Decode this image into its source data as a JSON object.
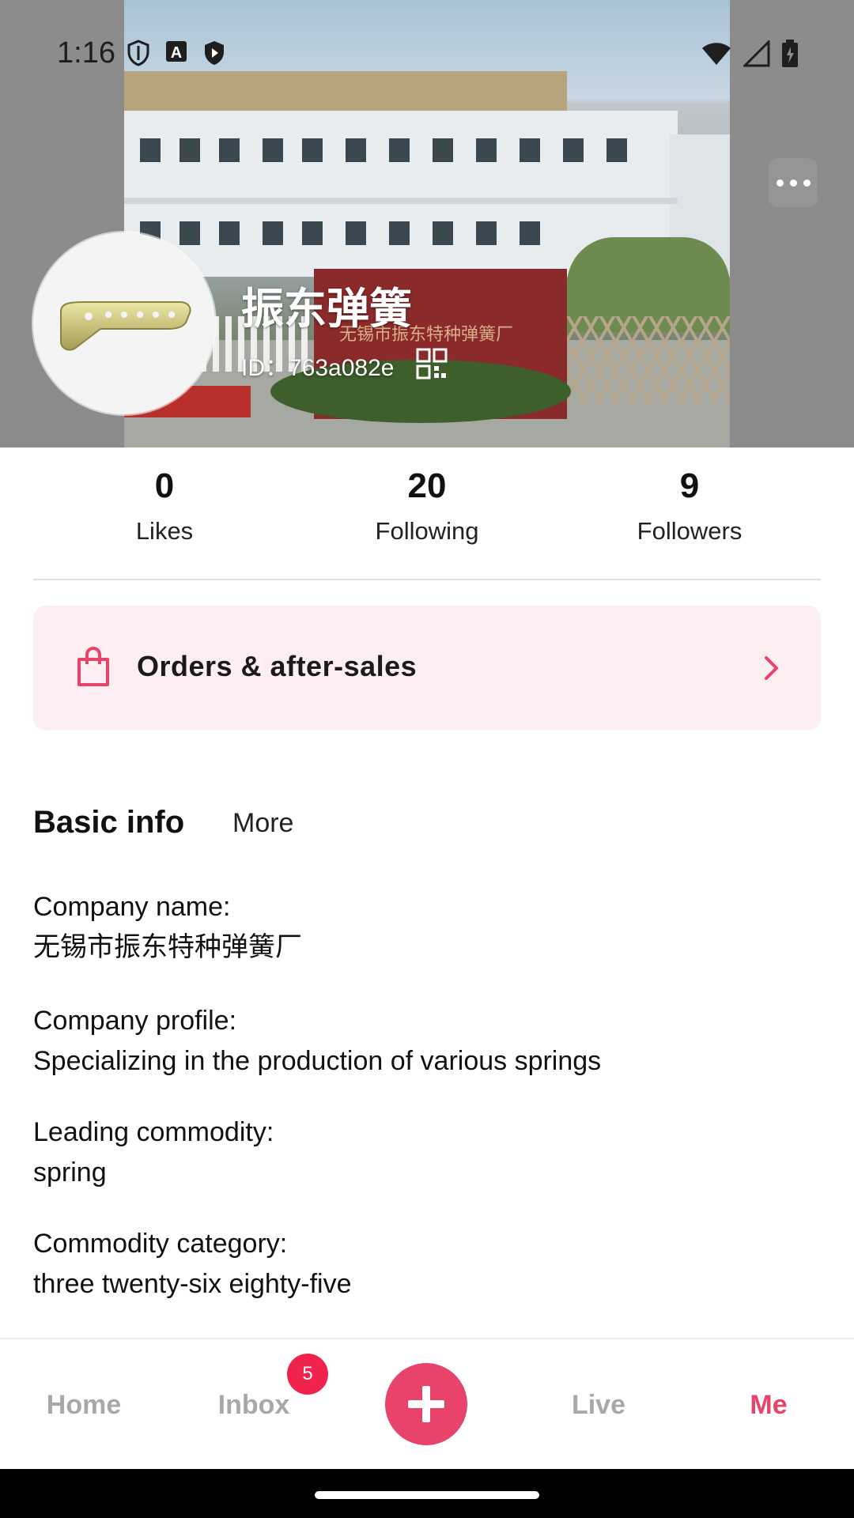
{
  "status_bar": {
    "time": "1:16"
  },
  "profile": {
    "name": "振东弹簧",
    "id_label": "ID：",
    "id_value": "763a082e",
    "cover_sign_text": "无锡市振东特种弹簧厂"
  },
  "stats": [
    {
      "value": "0",
      "label": "Likes"
    },
    {
      "value": "20",
      "label": "Following"
    },
    {
      "value": "9",
      "label": "Followers"
    }
  ],
  "orders": {
    "label": "Orders & after-sales"
  },
  "tabs": {
    "basic": "Basic info",
    "more": "More"
  },
  "info": [
    {
      "key": "Company name:",
      "value": "无锡市振东特种弹簧厂"
    },
    {
      "key": "Company profile:",
      "value": "Specializing in the production of various springs"
    },
    {
      "key": "Leading commodity:",
      "value": "spring"
    },
    {
      "key": "Commodity category:",
      "value": "three twenty-six eighty-five"
    }
  ],
  "nav": {
    "home": "Home",
    "inbox": "Inbox",
    "inbox_badge": "5",
    "live": "Live",
    "me": "Me"
  },
  "colors": {
    "accent": "#e8436a",
    "orders_bg": "#fdeef1",
    "badge": "#f0234e"
  },
  "icons": [
    "shield-icon",
    "font-a-icon",
    "play-shield-icon",
    "wifi-icon",
    "signal-icon",
    "battery-icon",
    "more-dots-icon",
    "qr-code-icon",
    "shopping-bag-icon",
    "chevron-right-icon",
    "plus-icon"
  ]
}
